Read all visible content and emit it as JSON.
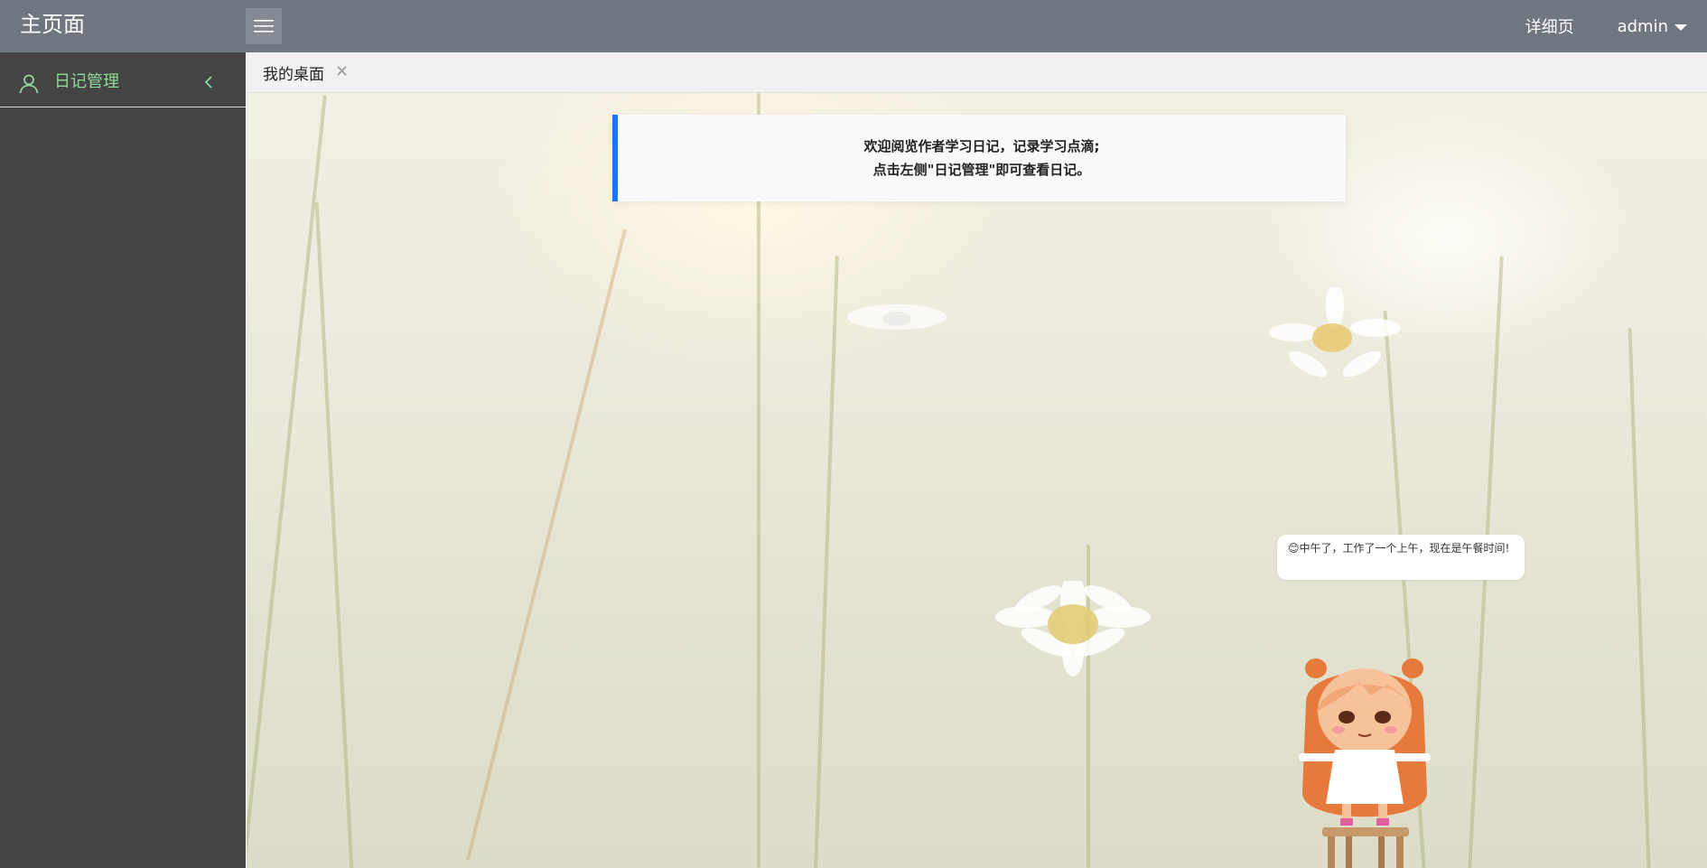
{
  "header": {
    "brand": "主页面",
    "detail_link": "详细页",
    "user_name": "admin"
  },
  "sidebar": {
    "items": [
      {
        "label": "日记管理",
        "icon": "user-icon",
        "expanded": false
      }
    ],
    "accent_color": "#8fd99a"
  },
  "tabs": [
    {
      "label": "我的桌面",
      "closable": true
    }
  ],
  "notice": {
    "line1": "欢迎阅览作者学习日记，记录学习点滴;",
    "line2": "点击左侧\"日记管理\"即可查看日记。",
    "accent_color": "#1677ff"
  },
  "mascot": {
    "emoji": "😊",
    "message": "中午了，工作了一个上午，现在是午餐时间!"
  },
  "colors": {
    "header_bg": "#6f7680",
    "sidebar_bg": "#444444"
  }
}
